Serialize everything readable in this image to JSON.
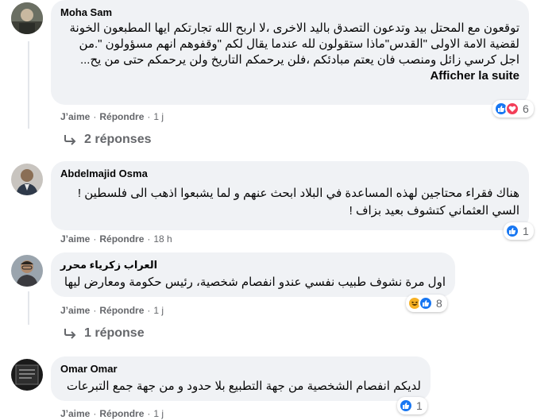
{
  "comments": [
    {
      "author": "Moha Sam",
      "text": "توقعون مع المحتل بيد وتدعون التصدق باليد الاخرى ،لا اربح الله تجارتكم ايها المطبعون الخونة لقضية الامة الاولى \"القدس\"ماذا ستقولون لله عندما يقال لكم \"وقفوهم انهم مسؤولون \".من اجل كرسي زائل ومنصب فان يعتم مبادئكم ،فلن يرحمكم التاريخ ولن يرحمكم حتى من يح...",
      "see_more": "Afficher la suite",
      "like": "J’aime",
      "reply": "Répondre",
      "time": "1 j",
      "reaction_count": "6",
      "replies": "2 réponses"
    },
    {
      "author": "Abdelmajid Osma",
      "text": "هناك فقراء محتاجين لهذه المساعدة في البلاد ابحث عنهم و لما يشبعوا اذهب الى فلسطين ! السي العثماني كتشوف بعيد بزاف !",
      "like": "J’aime",
      "reply": "Répondre",
      "time": "18 h",
      "reaction_count": "1"
    },
    {
      "author": "العراب زكرياء محرر",
      "text": "اول مرة نشوف طبيب نفسي عندو انفصام شخصية، رئيس حكومة ومعارض ليها",
      "like": "J’aime",
      "reply": "Répondre",
      "time": "1 j",
      "reaction_count": "8",
      "replies": "1 réponse"
    },
    {
      "author": "Omar Omar",
      "text": "لديكم انفصام الشخصية من جهة التطبيع بلا حدود و من جهة جمع التبرعات",
      "like": "J’aime",
      "reply": "Répondre",
      "time": "1 j",
      "reaction_count": "1"
    }
  ],
  "colors": {
    "bubble": "#f0f2f5",
    "meta": "#65676b",
    "like_blue": "#1877f2",
    "love_red": "#f33e58",
    "haha_yellow": "#f7b125"
  },
  "icons": [
    "like-icon",
    "love-icon",
    "haha-icon",
    "reply-arrow-icon"
  ]
}
